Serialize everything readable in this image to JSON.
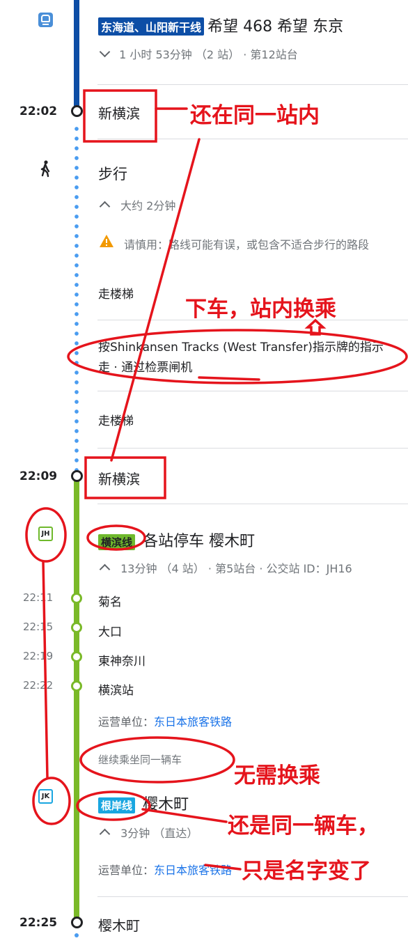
{
  "leg1": {
    "line_badge": "东海道、山阳新干线",
    "line_badge_color": "#0d4ea6",
    "destination": "希望 468 希望 东京",
    "summary": "1 小时 53分钟 （2 站） · 第12站台"
  },
  "stop1": {
    "time": "22:02",
    "name": "新横滨"
  },
  "walk": {
    "title": "步行",
    "duration": "大约 2分钟",
    "warning": "请慎用：路线可能有误，或包含不适合步行的路段",
    "step1": "走楼梯",
    "step2": "按Shinkansen Tracks (West Transfer)指示牌的指示走 · 通过检票闸机",
    "step3": "走楼梯"
  },
  "stop2": {
    "time": "22:09",
    "name": "新横滨"
  },
  "leg2": {
    "icon_label": "JH",
    "line_badge": "横滨线",
    "line_badge_color": "#6fb92c",
    "destination": "各站停车 樱木町",
    "summary": "13分钟 （4 站） · 第5站台 · 公交站 ID：JH16",
    "stops": [
      {
        "time": "22:11",
        "name": "菊名"
      },
      {
        "time": "22:15",
        "name": "大口"
      },
      {
        "time": "22:19",
        "name": "東神奈川"
      },
      {
        "time": "22:22",
        "name": "横滨站"
      }
    ],
    "operator_label": "运营单位：",
    "operator": "东日本旅客铁路",
    "continue_note": "继续乘坐同一辆车"
  },
  "leg3": {
    "icon_label": "JK",
    "line_badge": "根岸线",
    "line_badge_color": "#19a6e0",
    "destination": "樱木町",
    "summary": "3分钟 （直达）",
    "operator_label": "运营单位：",
    "operator": "东日本旅客铁路"
  },
  "stop3": {
    "time": "22:25",
    "name": "樱木町"
  },
  "annotations": {
    "a1": "还在同一站内",
    "a2": "下车，站内换乘",
    "a3": "无需换乘",
    "a4": "还是同一辆车，",
    "a5": "只是名字变了"
  },
  "colors": {
    "shinkansen": "#0d4ea6",
    "walk_dots": "#4a9cf0",
    "jr_green": "#7ab928",
    "annotation": "#e5141c"
  }
}
